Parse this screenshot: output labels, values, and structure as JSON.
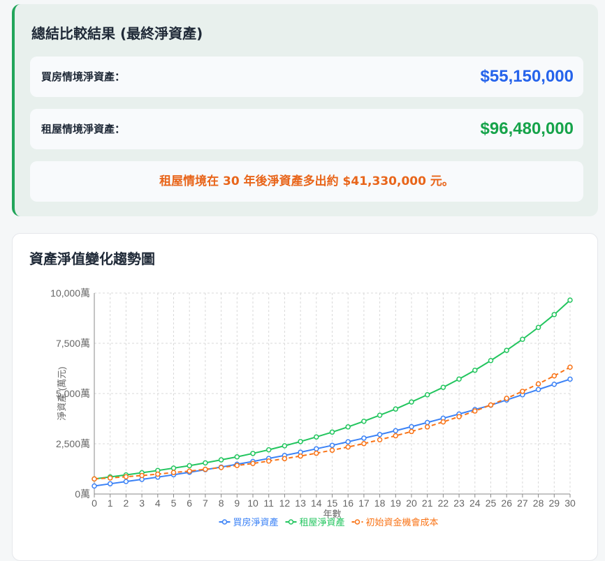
{
  "summary": {
    "title": "總結比較結果 (最終淨資產)",
    "buy_label": "買房情境淨資產：",
    "buy_value": "$55,150,000",
    "rent_label": "租屋情境淨資產：",
    "rent_value": "$96,480,000",
    "conclusion": "租屋情境在 30 年後淨資產多出約 $41,330,000 元。"
  },
  "colors": {
    "buy": "#3b82f6",
    "rent": "#22c55e",
    "opportunity": "#f97316",
    "accent_bar": "#22a55a",
    "buy_text": "#2563eb",
    "rent_text": "#16a34a",
    "conclusion_text": "#e8651a"
  },
  "chart_data": {
    "type": "line",
    "title": "資產淨值變化趨勢圖",
    "xlabel": "年數",
    "ylabel": "淨資產 (萬元)",
    "ylim": [
      0,
      10000
    ],
    "yticks": [
      "0萬",
      "2,500萬",
      "5,000萬",
      "7,500萬",
      "10,000萬"
    ],
    "ytick_values": [
      0,
      2500,
      5000,
      7500,
      10000
    ],
    "grid": true,
    "legend_position": "bottom",
    "x": [
      0,
      1,
      2,
      3,
      4,
      5,
      6,
      7,
      8,
      9,
      10,
      11,
      12,
      13,
      14,
      15,
      16,
      17,
      18,
      19,
      20,
      21,
      22,
      23,
      24,
      25,
      26,
      27,
      28,
      29,
      30
    ],
    "series": [
      {
        "name": "買房淨資產",
        "color": "#3b82f6",
        "dashed": false,
        "values": [
          400,
          510,
          620,
          730,
          840,
          960,
          1080,
          1210,
          1340,
          1480,
          1620,
          1770,
          1920,
          2080,
          2250,
          2420,
          2600,
          2780,
          2960,
          3150,
          3350,
          3560,
          3770,
          3980,
          4200,
          4420,
          4680,
          4940,
          5200,
          5460,
          5715
        ]
      },
      {
        "name": "租屋淨資產",
        "color": "#22c55e",
        "dashed": false,
        "values": [
          750,
          850,
          950,
          1060,
          1170,
          1290,
          1410,
          1550,
          1700,
          1850,
          2020,
          2200,
          2400,
          2610,
          2840,
          3080,
          3340,
          3620,
          3920,
          4230,
          4580,
          4940,
          5310,
          5720,
          6160,
          6640,
          7150,
          7700,
          8290,
          8930,
          9648
        ]
      },
      {
        "name": "初始資金機會成本",
        "color": "#f97316",
        "dashed": true,
        "values": [
          750,
          800,
          860,
          920,
          990,
          1070,
          1140,
          1230,
          1320,
          1420,
          1520,
          1640,
          1760,
          1890,
          2030,
          2180,
          2340,
          2510,
          2700,
          2900,
          3110,
          3340,
          3590,
          3850,
          4130,
          4430,
          4760,
          5110,
          5480,
          5880,
          6310
        ]
      }
    ]
  }
}
